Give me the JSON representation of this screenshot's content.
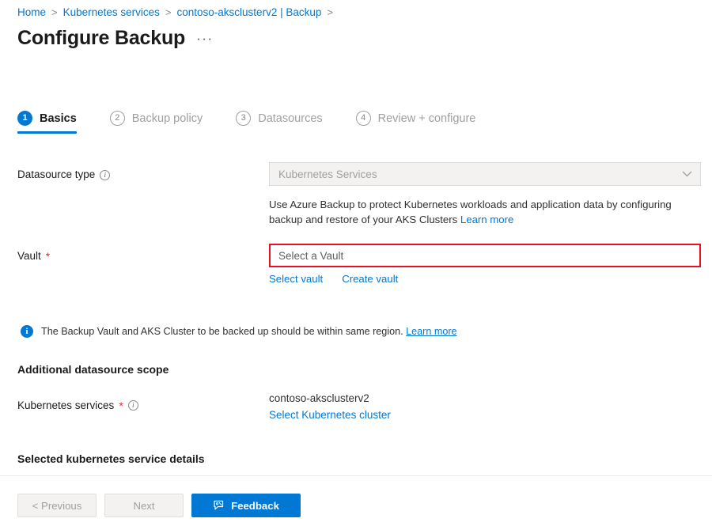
{
  "breadcrumb": {
    "items": [
      {
        "label": "Home"
      },
      {
        "label": "Kubernetes services"
      },
      {
        "label": "contoso-aksclusterv2 | Backup"
      }
    ],
    "separator": ">"
  },
  "header": {
    "title": "Configure Backup",
    "more_label": "···"
  },
  "wizard": {
    "tabs": [
      {
        "num": "1",
        "label": "Basics",
        "state": "active"
      },
      {
        "num": "2",
        "label": "Backup policy",
        "state": "inactive"
      },
      {
        "num": "3",
        "label": "Datasources",
        "state": "inactive"
      },
      {
        "num": "4",
        "label": "Review + configure",
        "state": "inactive"
      }
    ]
  },
  "form": {
    "datasource_type": {
      "label": "Datasource type",
      "info_glyph": "i",
      "value": "Kubernetes Services",
      "chevron": "⌄",
      "help_text": "Use Azure Backup to protect Kubernetes workloads and application data by configuring backup and restore of your AKS Clusters ",
      "help_link": "Learn more"
    },
    "vault": {
      "label": "Vault",
      "required_mark": "*",
      "placeholder": "Select a Vault",
      "value": "",
      "select_link": "Select vault",
      "create_link": "Create vault"
    }
  },
  "info_banner": {
    "icon_glyph": "i",
    "text": "The Backup Vault and AKS Cluster to be backed up should be within same region. ",
    "link": "Learn more"
  },
  "scope_section": {
    "heading": "Additional datasource scope",
    "field_label": "Kubernetes services",
    "required_mark": "*",
    "info_glyph": "i",
    "value": "contoso-aksclusterv2",
    "link": "Select Kubernetes cluster"
  },
  "details_section": {
    "heading": "Selected kubernetes service details"
  },
  "footer": {
    "previous_label": "< Previous",
    "next_label": "Next",
    "feedback_label": "Feedback"
  },
  "colors": {
    "accent": "#0078d4",
    "error_border": "#e81123",
    "required_star": "#d13438",
    "disabled_text": "#a19f9d"
  }
}
